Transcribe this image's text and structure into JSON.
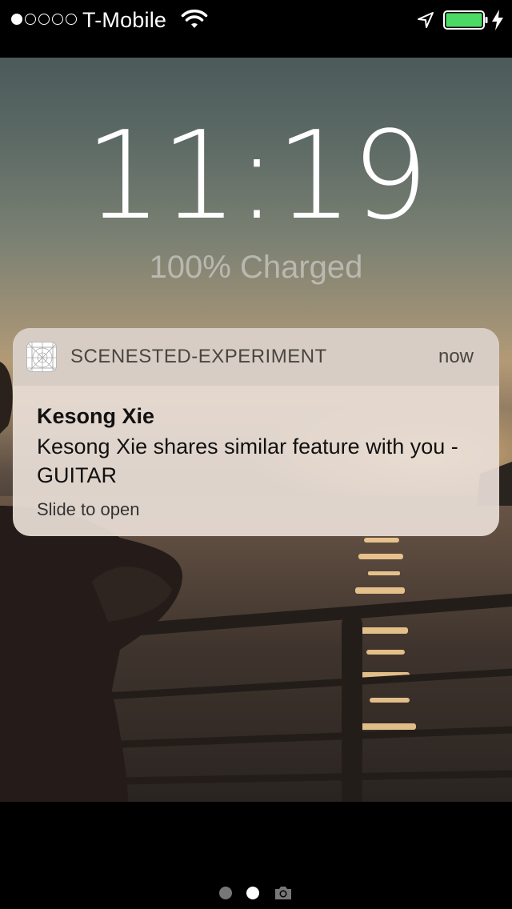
{
  "status_bar": {
    "carrier": "T-Mobile",
    "signal_strength": 1,
    "signal_max": 5,
    "icons": [
      "wifi-icon",
      "location-arrow-icon",
      "battery-icon",
      "charging-bolt-icon"
    ],
    "battery_level": 1.0,
    "battery_color": "#4cd964"
  },
  "lock_screen": {
    "time": "11:19",
    "charge_status": "100% Charged"
  },
  "notification": {
    "app_name": "SCENESTED-EXPERIMENT",
    "timestamp": "now",
    "title": "Kesong Xie",
    "message": "Kesong Xie shares similar feature with you - GUITAR",
    "action": "Slide to open"
  },
  "pager": {
    "pages": 2,
    "active_index": 1,
    "trailing_icon": "camera-icon"
  }
}
